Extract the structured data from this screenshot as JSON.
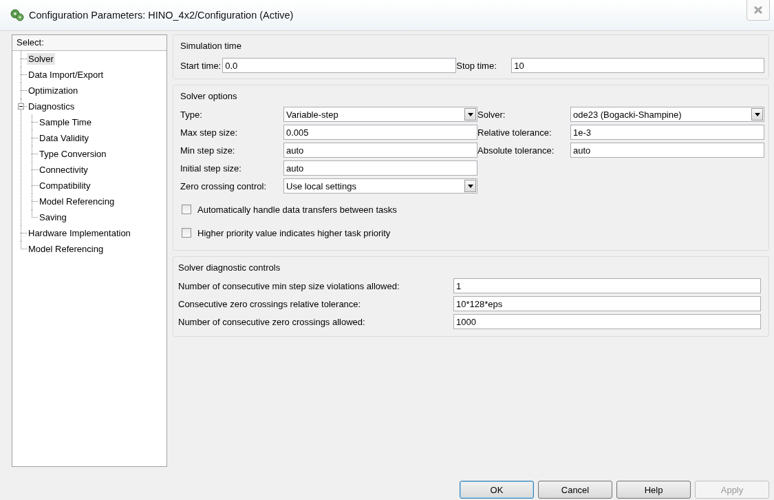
{
  "window": {
    "title": "Configuration Parameters: HINO_4x2/Configuration (Active)"
  },
  "sidebar": {
    "header": "Select:",
    "items": [
      {
        "label": "Solver",
        "selected": true
      },
      {
        "label": "Data Import/Export",
        "selected": false
      },
      {
        "label": "Optimization",
        "selected": false
      },
      {
        "label": "Diagnostics",
        "selected": false,
        "expanded": true,
        "children": [
          {
            "label": "Sample Time",
            "selected": false
          },
          {
            "label": "Data Validity",
            "selected": false
          },
          {
            "label": "Type Conversion",
            "selected": false
          },
          {
            "label": "Connectivity",
            "selected": false
          },
          {
            "label": "Compatibility",
            "selected": false
          },
          {
            "label": "Model Referencing",
            "selected": false
          },
          {
            "label": "Saving",
            "selected": false
          }
        ]
      },
      {
        "label": "Hardware Implementation",
        "selected": false
      },
      {
        "label": "Model Referencing",
        "selected": false
      }
    ]
  },
  "simulation_time": {
    "title": "Simulation time",
    "fields": [
      {
        "label": "Start time:",
        "value": "0.0",
        "kind": "text"
      },
      {
        "label": "Stop time:",
        "value": "10",
        "kind": "text"
      }
    ]
  },
  "solver_options": {
    "title": "Solver options",
    "rows": [
      [
        {
          "label": "Type:",
          "value": "Variable-step",
          "kind": "dropdown"
        },
        {
          "label": "Solver:",
          "value": "ode23 (Bogacki-Shampine)",
          "kind": "dropdown"
        }
      ],
      [
        {
          "label": "Max step size:",
          "value": "0.005",
          "kind": "text"
        },
        {
          "label": "Relative tolerance:",
          "value": "1e-3",
          "kind": "text"
        }
      ],
      [
        {
          "label": "Min step size:",
          "value": "auto",
          "kind": "text"
        },
        {
          "label": "Absolute tolerance:",
          "value": "auto",
          "kind": "text"
        }
      ],
      [
        {
          "label": "Initial step size:",
          "value": "auto",
          "kind": "text"
        }
      ],
      [
        {
          "label": "Zero crossing control:",
          "value": "Use local settings",
          "kind": "dropdown"
        }
      ]
    ],
    "checkboxes": [
      {
        "label": "Automatically handle data transfers between tasks",
        "checked": false
      },
      {
        "label": "Higher priority value indicates higher task priority",
        "checked": false
      }
    ]
  },
  "diagnostic_controls": {
    "title": "Solver diagnostic controls",
    "fields": [
      {
        "label": "Number of consecutive min step size violations allowed:",
        "value": "1",
        "kind": "text"
      },
      {
        "label": "Consecutive zero crossings relative tolerance:",
        "value": "10*128*eps",
        "kind": "text"
      },
      {
        "label": "Number of consecutive zero crossings allowed:",
        "value": "1000",
        "kind": "text"
      }
    ]
  },
  "buttons": [
    {
      "label": "OK",
      "default": true,
      "disabled": false
    },
    {
      "label": "Cancel",
      "default": false,
      "disabled": false
    },
    {
      "label": "Help",
      "default": false,
      "disabled": false
    },
    {
      "label": "Apply",
      "default": false,
      "disabled": true
    }
  ]
}
